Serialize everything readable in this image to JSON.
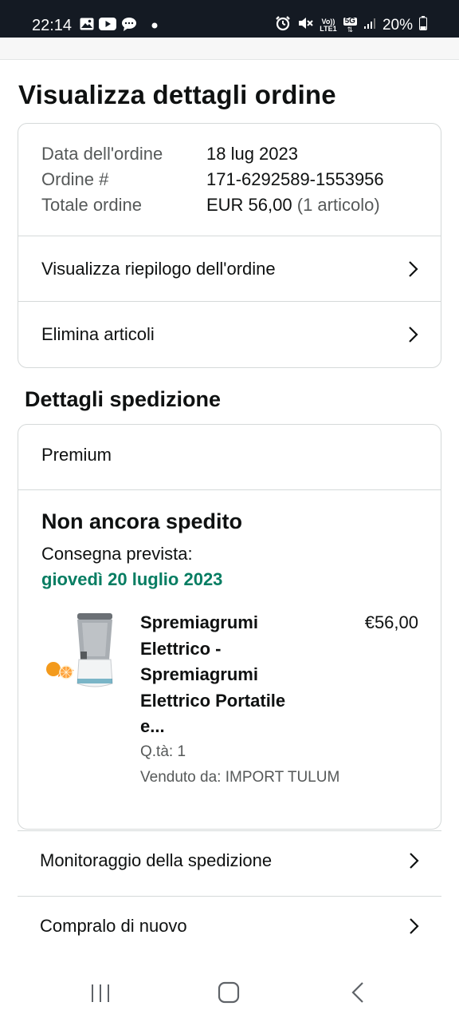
{
  "status_bar": {
    "time": "22:14",
    "left_icons": [
      "gallery-icon",
      "youtube-icon",
      "chat-icon",
      "dot-icon"
    ],
    "right_icons": [
      "alarm-icon",
      "mute-icon",
      "volte-icon",
      "5g-icon",
      "signal-icon"
    ],
    "volte_label": "Vo))",
    "volte_sub": "LTE1",
    "network_label": "5G",
    "battery": "20%"
  },
  "page": {
    "title": "Visualizza dettagli ordine"
  },
  "order": {
    "date_label": "Data dell'ordine",
    "date_value": "18 lug 2023",
    "number_label": "Ordine #",
    "number_value": "171-6292589-1553956",
    "total_label": "Totale ordine",
    "total_value": "EUR 56,00",
    "total_items": "(1 articolo)",
    "summary_link": "Visualizza riepilogo dell'ordine",
    "delete_link": "Elimina articoli"
  },
  "shipping": {
    "section_title": "Dettagli spedizione",
    "tier": "Premium",
    "status": "Non ancora spedito",
    "delivery_label": "Consegna prevista:",
    "delivery_date": "giovedì 20 luglio 2023",
    "product": {
      "title": "Spremiagrumi Elettrico - Spremiagrumi Elettrico Portatile e...",
      "price": "€56,00",
      "quantity": "Q.tà: 1",
      "seller": "Venduto da: IMPORT TULUM"
    }
  },
  "actions": {
    "track": "Monitoraggio della spedizione",
    "buy_again": "Compralo di nuovo"
  },
  "nav": [
    "recent-apps-icon",
    "home-icon",
    "back-icon"
  ],
  "colors": {
    "status_bar_bg": "#141a23",
    "delivery_green": "#067d62",
    "border": "#d5d9d9",
    "muted_text": "#565959"
  }
}
